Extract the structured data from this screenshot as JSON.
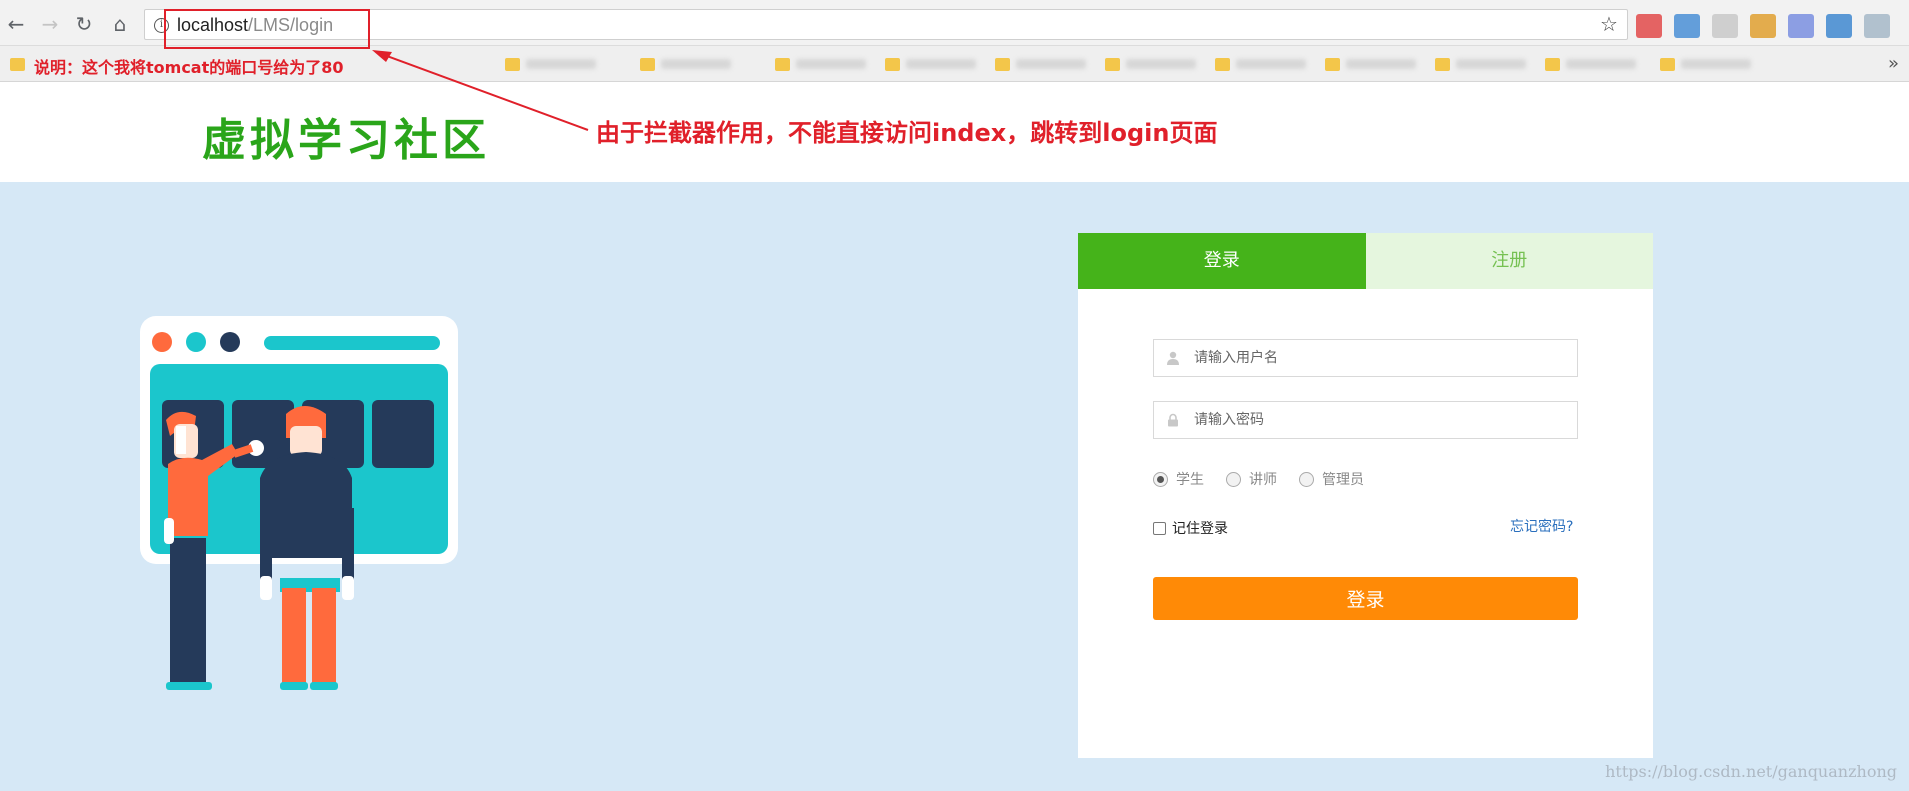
{
  "browser": {
    "url_host": "localhost",
    "url_path": "/LMS/login",
    "bookmark_note": "说明：这个我将tomcat的端口号给为了80",
    "more_label": "»"
  },
  "header": {
    "logo": "虚拟学习社区",
    "annotation": "由于拦截器作用，不能直接访问index，跳转到login页面"
  },
  "login": {
    "tabs": [
      {
        "label": "登录",
        "active": true
      },
      {
        "label": "注册",
        "active": false
      }
    ],
    "username_placeholder": "请输入用户名",
    "password_placeholder": "请输入密码",
    "roles": [
      {
        "label": "学生",
        "checked": true
      },
      {
        "label": "讲师",
        "checked": false
      },
      {
        "label": "管理员",
        "checked": false
      }
    ],
    "remember_label": "记住登录",
    "forgot_label": "忘记密码?",
    "submit_label": "登录"
  },
  "watermark": "https://blog.csdn.net/ganquanzhong",
  "colors": {
    "brand_green": "#45b31a",
    "accent_orange": "#ff8a06",
    "annotation_red": "#e0202a",
    "page_bg": "#d6e8f6"
  }
}
